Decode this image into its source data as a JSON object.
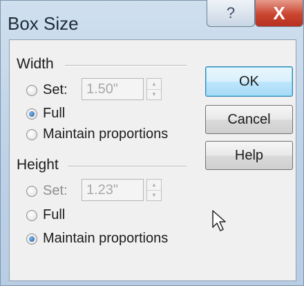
{
  "window": {
    "title": "Box Size",
    "help_glyph": "?",
    "close_glyph": "X"
  },
  "width_group": {
    "title": "Width",
    "set_label": "Set:",
    "set_value": "1.50\"",
    "full_label": "Full",
    "maintain_label": "Maintain proportions",
    "selected": "full"
  },
  "height_group": {
    "title": "Height",
    "set_label": "Set:",
    "set_value": "1.23\"",
    "full_label": "Full",
    "maintain_label": "Maintain proportions",
    "selected": "maintain"
  },
  "buttons": {
    "ok": "OK",
    "cancel": "Cancel",
    "help": "Help"
  },
  "icons": {
    "help": "help-icon",
    "close": "close-icon",
    "spin_up": "spin-up-icon",
    "spin_down": "spin-down-icon",
    "cursor": "mouse-pointer-icon"
  }
}
